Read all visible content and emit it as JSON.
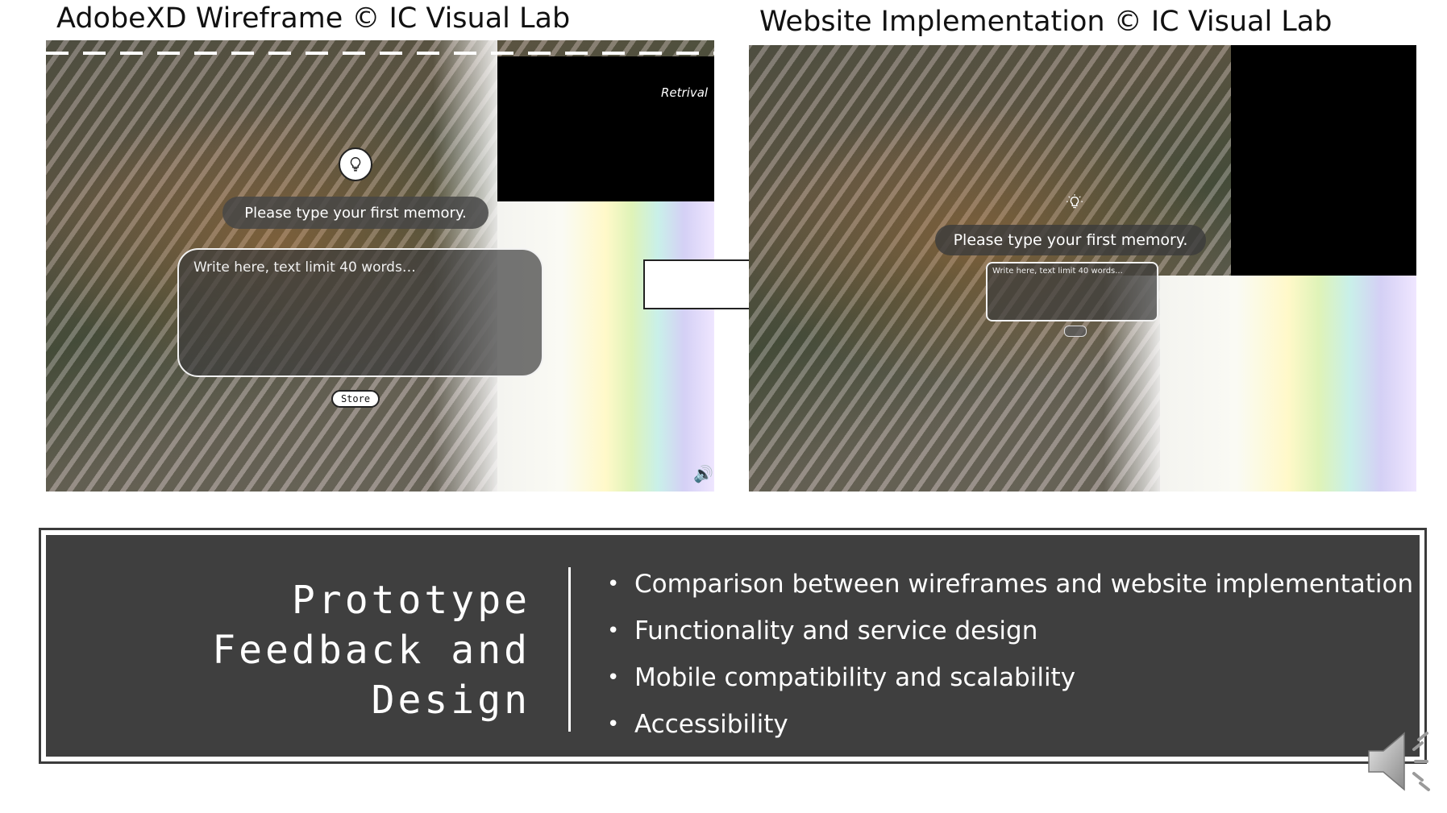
{
  "slide": {
    "left_caption": "AdobeXD Wireframe © IC Visual Lab",
    "right_caption": "Website Implementation © IC Visual Lab"
  },
  "wireframe": {
    "nav_label": "Retrival",
    "prompt": "Please type your first memory.",
    "placeholder": "Write here, text limit 40 words…",
    "store_button": "Store"
  },
  "implementation": {
    "prompt": "Please type your first memory.",
    "placeholder": "Write here, text limit 40 words..."
  },
  "info": {
    "title_line1": "Prototype",
    "title_line2": "Feedback and",
    "title_line3": "Design",
    "bullets": [
      "Comparison between wireframes and website implementation",
      "Functionality and service design",
      "Mobile compatibility and scalability",
      "Accessibility"
    ]
  },
  "icons": {
    "lightbulb": "lightbulb-icon",
    "speaker": "speaker-icon",
    "arrow": "arrow-right-icon"
  }
}
